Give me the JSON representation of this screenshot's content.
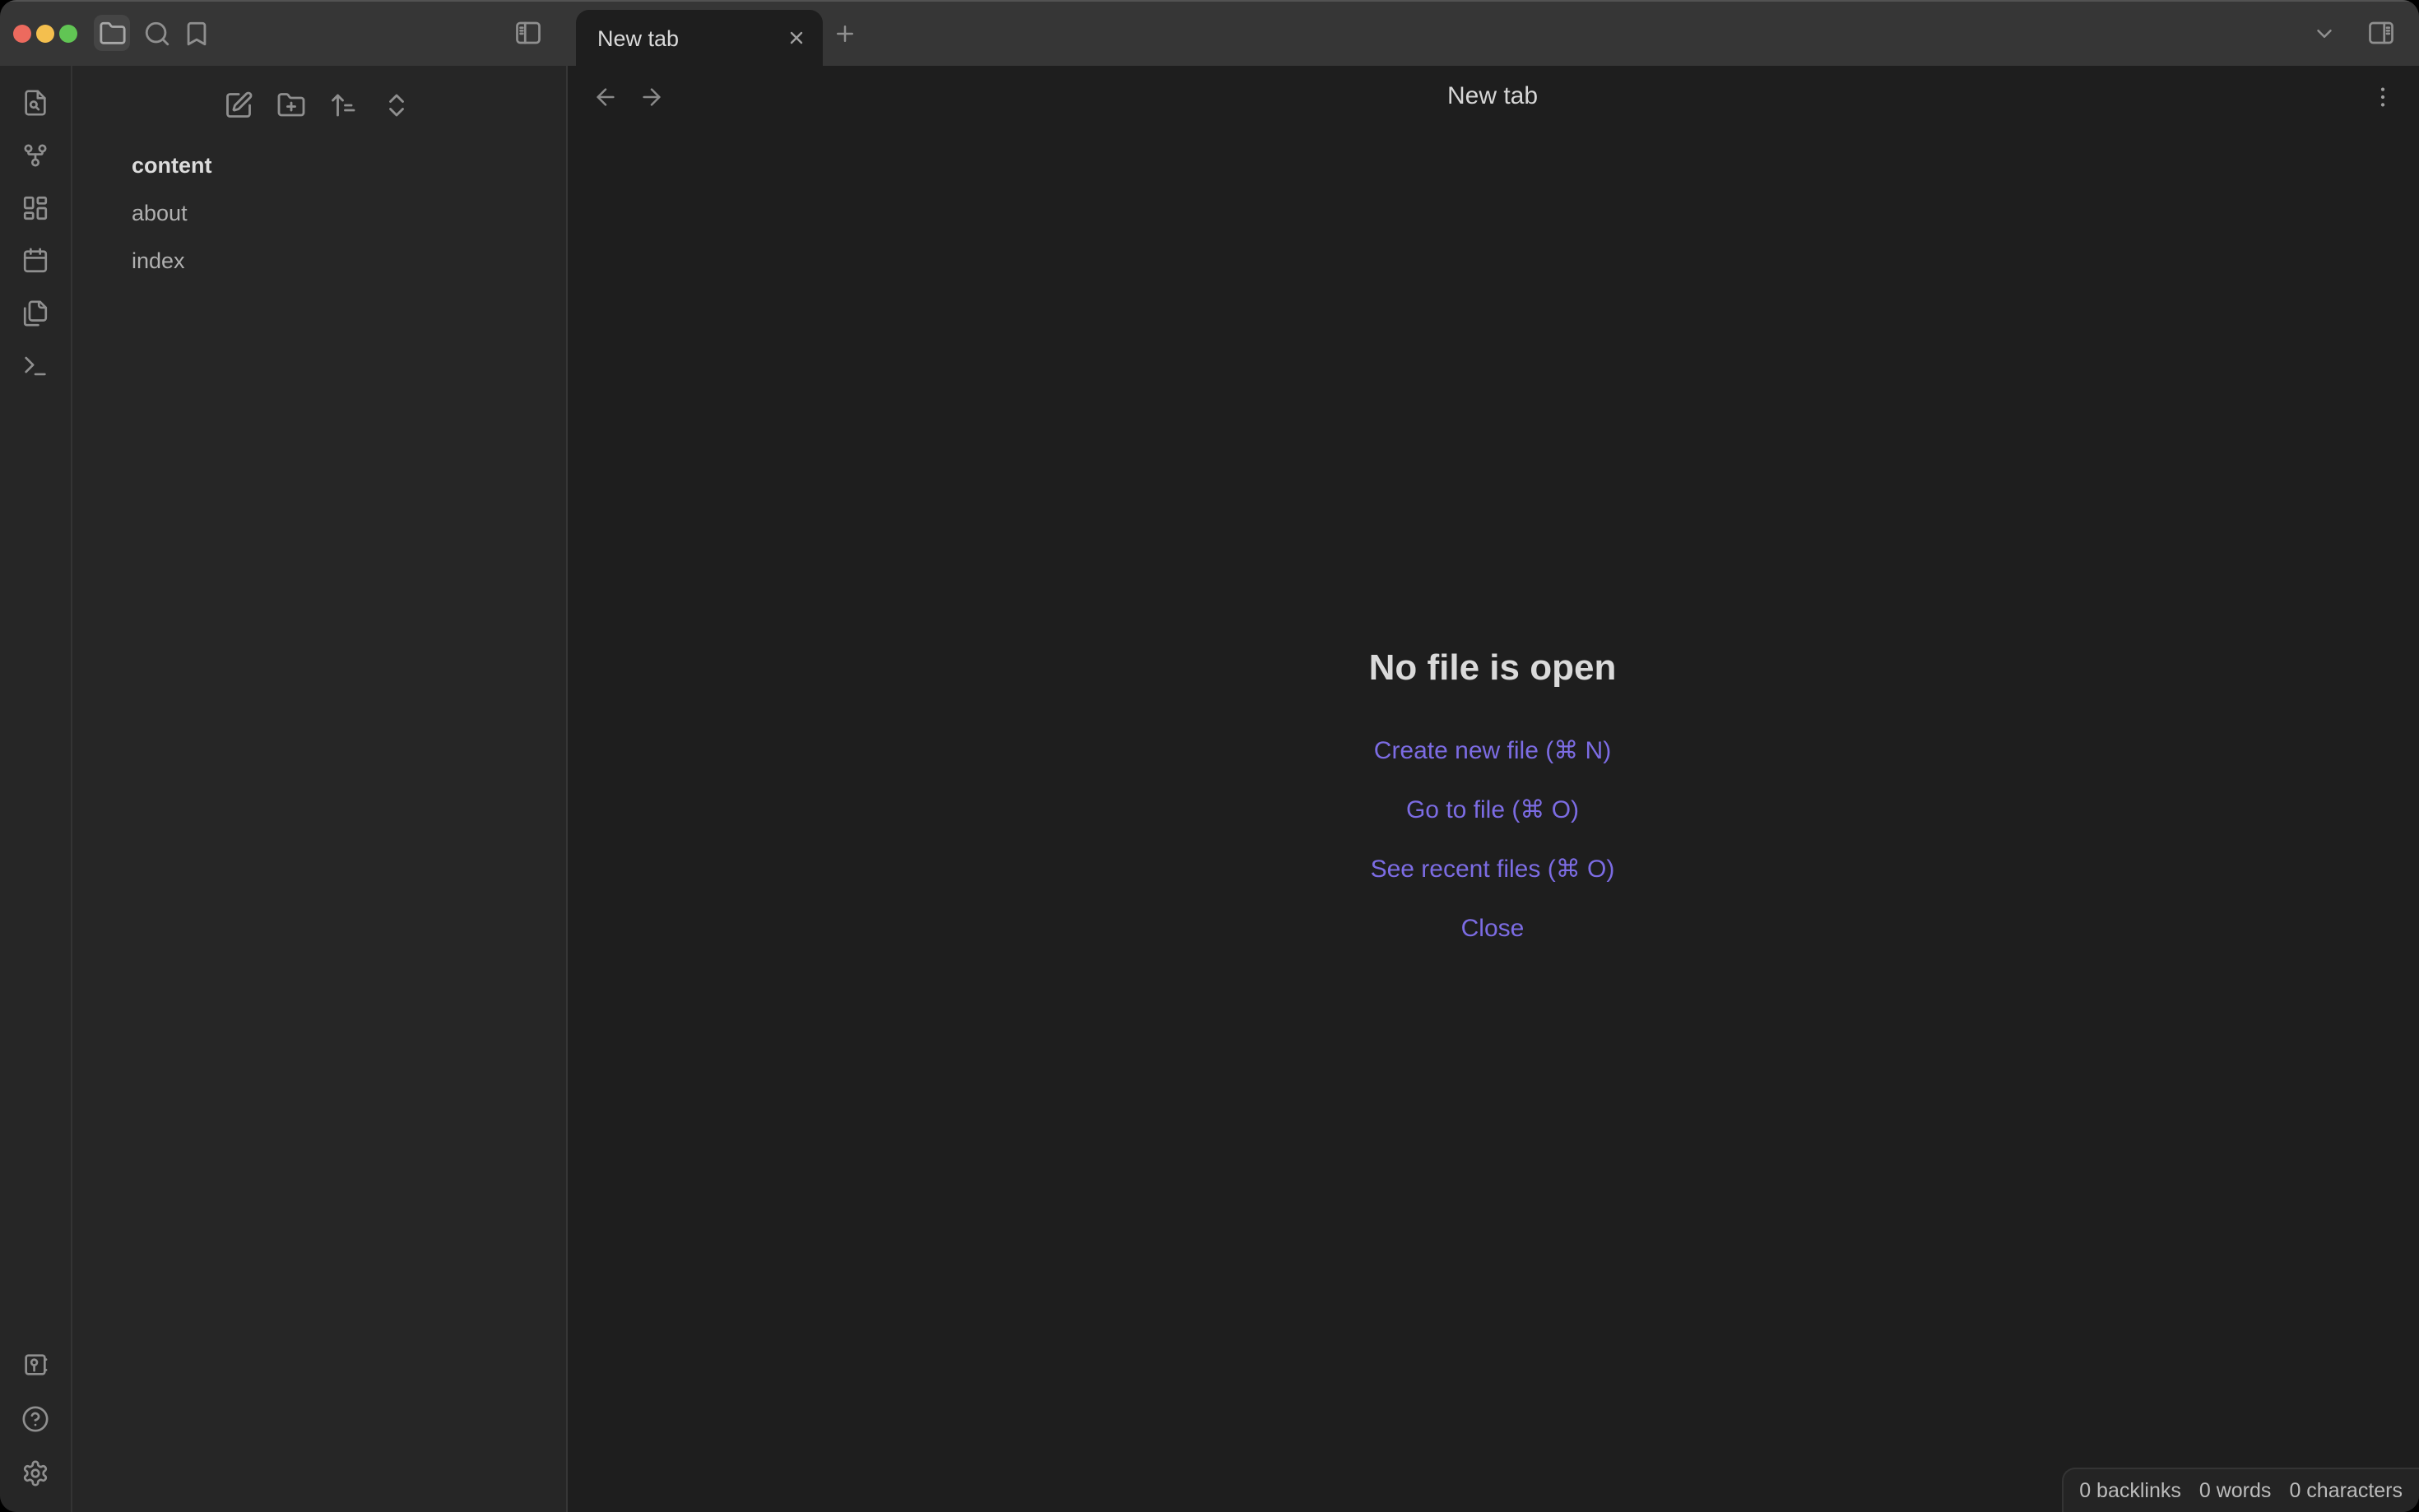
{
  "window": {
    "traffic_lights": [
      {
        "name": "close"
      },
      {
        "name": "minimize"
      },
      {
        "name": "zoom"
      }
    ]
  },
  "titlebar": {
    "left_icons": [
      "folder-icon",
      "search-icon",
      "bookmark-icon"
    ],
    "active_icon": "folder-icon",
    "sidebar_toggle_left_icon": "panel-left-icon",
    "tab": {
      "label": "New tab",
      "close_icon": "x-icon"
    },
    "new_tab_icon": "plus-icon",
    "right_icons": [
      "chevron-down-icon",
      "panel-right-icon"
    ]
  },
  "ribbon": {
    "top_icons": [
      "file-search-icon",
      "graph-icon",
      "dashboard-icon",
      "calendar-icon",
      "files-icon",
      "terminal-icon"
    ],
    "bottom_icons": [
      "vault-icon",
      "help-icon",
      "settings-icon"
    ]
  },
  "sidebar": {
    "toolbar_icons": [
      "new-note-icon",
      "new-folder-icon",
      "sort-order-icon",
      "collapse-all-icon"
    ],
    "files": [
      {
        "name": "content",
        "type": "folder"
      },
      {
        "name": "about",
        "type": "file"
      },
      {
        "name": "index",
        "type": "file"
      }
    ]
  },
  "main": {
    "header": {
      "title": "New tab",
      "back_icon": "arrow-left-icon",
      "forward_icon": "arrow-right-icon",
      "menu_icon": "more-options-icon"
    },
    "empty_state": {
      "heading": "No file is open",
      "actions": [
        {
          "label": "Create new file (⌘ N)"
        },
        {
          "label": "Go to file (⌘ O)"
        },
        {
          "label": "See recent files (⌘ O)"
        },
        {
          "label": "Close"
        }
      ]
    },
    "status_bar": {
      "backlinks": "0 backlinks",
      "words": "0 words",
      "characters": "0 characters"
    }
  },
  "colors": {
    "accent": "#7c6ce3",
    "titlebar_bg": "#363636",
    "sidebar_bg": "#262626",
    "editor_bg": "#1e1e1e",
    "traffic_red": "#ec6a5e",
    "traffic_yellow": "#f4bf4e",
    "traffic_green": "#61c554"
  }
}
